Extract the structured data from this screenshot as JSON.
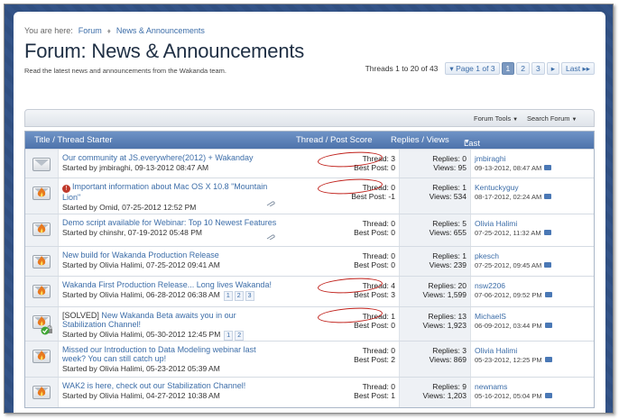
{
  "breadcrumb": {
    "prefix": "You are here:",
    "items": [
      "Forum",
      "News & Announcements"
    ]
  },
  "page": {
    "title": "Forum: News & Announcements",
    "description": "Read the latest news and announcements from the Wakanda team."
  },
  "pagination": {
    "info": "Threads 1 to 20 of 43",
    "page_of": "Page 1 of 3",
    "pages": [
      "1",
      "2",
      "3"
    ],
    "next": "▸",
    "last": "Last ▸▸"
  },
  "toolbar": {
    "forum_tools": "Forum Tools",
    "search_forum": "Search Forum"
  },
  "columns": {
    "title": "Title / Thread Starter",
    "score": "Thread / Post Score",
    "replies_views": "Replies / Views",
    "last_post": "Last Post By"
  },
  "threads": [
    {
      "title": "Our community at JS.everywhere(2012) + Wakanday",
      "starter": "Started by jmbiraghi, 09-13-2012 08:47 AM",
      "thread_score": "Thread: 3",
      "post_score": "Best Post: 0",
      "replies": "Replies: 0",
      "views": "Views: 95",
      "last_user": "jmbiraghi",
      "last_date": "09-13-2012, 08:47 AM"
    },
    {
      "title": "Important information about Mac OS X 10.8 \"Mountain Lion\"",
      "starter": "Started by Omid, 07-25-2012 12:52 PM",
      "thread_score": "Thread: 0",
      "post_score": "Best Post: -1",
      "replies": "Replies: 1",
      "views": "Views: 534",
      "last_user": "Kentuckyguy",
      "last_date": "08-17-2012, 02:24 AM"
    },
    {
      "title": "Demo script available for Webinar: Top 10 Newest Features",
      "starter": "Started by chinshr, 07-19-2012 05:48 PM",
      "thread_score": "Thread: 0",
      "post_score": "Best Post: 0",
      "replies": "Replies: 5",
      "views": "Views: 655",
      "last_user": "Olivia Halimi",
      "last_date": "07-25-2012, 11:32 AM"
    },
    {
      "title": "New build for Wakanda Production Release",
      "starter": "Started by Olivia Halimi, 07-25-2012 09:41 AM",
      "thread_score": "Thread: 0",
      "post_score": "Best Post: 0",
      "replies": "Replies: 1",
      "views": "Views: 239",
      "last_user": "pkesch",
      "last_date": "07-25-2012, 09:45 AM"
    },
    {
      "title": "Wakanda First Production Release... Long lives Wakanda!",
      "starter": "Started by Olivia Halimi, 06-28-2012 06:38 AM",
      "pages": [
        "1",
        "2",
        "3"
      ],
      "thread_score": "Thread: 4",
      "post_score": "Best Post: 3",
      "replies": "Replies: 20",
      "views": "Views: 1,599",
      "last_user": "nsw2206",
      "last_date": "07-06-2012, 09:52 PM"
    },
    {
      "prefix": "[SOLVED]",
      "title": "New Wakanda Beta awaits you in our Stabilization Channel!",
      "starter": "Started by Olivia Halimi, 05-30-2012 12:45 PM",
      "pages": [
        "1",
        "2"
      ],
      "thread_score": "Thread: 1",
      "post_score": "Best Post: 0",
      "replies": "Replies: 13",
      "views": "Views: 1,923",
      "last_user": "MichaelS",
      "last_date": "06-09-2012, 03:44 PM"
    },
    {
      "title": "Missed our Introduction to Data Modeling webinar last week? You can still catch up!",
      "starter": "Started by Olivia Halimi, 05-23-2012 05:39 AM",
      "thread_score": "Thread: 0",
      "post_score": "Best Post: 2",
      "replies": "Replies: 3",
      "views": "Views: 869",
      "last_user": "Olivia Halimi",
      "last_date": "05-23-2012, 12:25 PM"
    },
    {
      "title": "WAK2 is here, check out our Stabilization Channel!",
      "starter": "Started by Olivia Halimi, 04-27-2012 10:38 AM",
      "thread_score": "Thread: 0",
      "post_score": "Best Post: 1",
      "replies": "Replies: 9",
      "views": "Views: 1,203",
      "last_user": "newnams",
      "last_date": "05-16-2012, 05:04 PM"
    }
  ],
  "colors": {
    "link": "#3c6da8",
    "header_bg": "#5a80b8",
    "annotation_circle": "#c0201a"
  }
}
